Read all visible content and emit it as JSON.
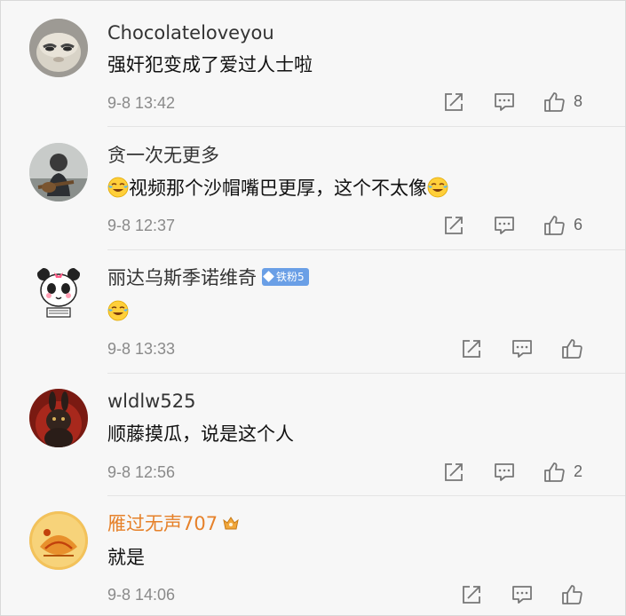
{
  "comments": [
    {
      "username": "Chocolateloveyou",
      "text": "强奸犯变成了爱过人士啦",
      "time": "9-8 13:42",
      "likes": "8",
      "avatar": "cat-avatar"
    },
    {
      "username": "贪一次无更多",
      "text": "视频那个沙帽嘴巴更厚，这个不太像",
      "time": "9-8 12:37",
      "likes": "6",
      "avatar": "person-guitar-avatar"
    },
    {
      "username": "丽达乌斯季诺维奇",
      "badge": "铁粉5",
      "text": "",
      "time": "9-8 13:33",
      "likes": "",
      "avatar": "panda-avatar"
    },
    {
      "username": "wldlw525",
      "text": "顺藤摸瓜，说是这个人",
      "time": "9-8 12:56",
      "likes": "2",
      "avatar": "rabbit-avatar"
    },
    {
      "username": "雁过无声707",
      "text": "就是",
      "time": "9-8 14:06",
      "likes": "",
      "avatar": "gold-avatar"
    }
  ],
  "colors": {
    "background": "#f7f7f7",
    "username": "#333333",
    "vip_username": "#e6812a",
    "time": "#8a8a8a",
    "badge": "#6a9fe6"
  },
  "icons": [
    "share-icon",
    "comment-icon",
    "like-icon",
    "laugh-cry-emoji",
    "vip-crown-icon"
  ]
}
